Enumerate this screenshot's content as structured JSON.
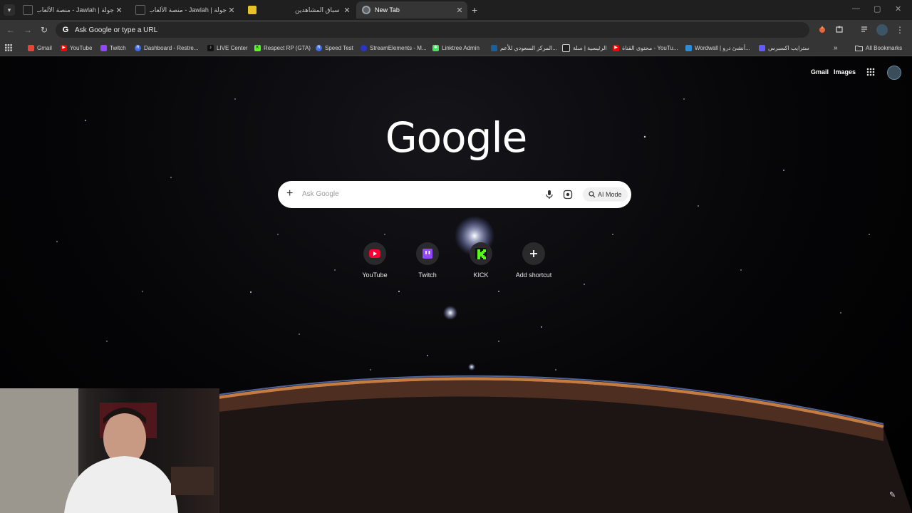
{
  "tabs": [
    {
      "title": "جولة | Jawlah - منصة الألعاب الت..."
    },
    {
      "title": "جولة | Jawlah - منصة الألعاب الت..."
    },
    {
      "title": ""
    },
    {
      "title": "سباق المشاهدين"
    },
    {
      "title": "New Tab",
      "active": true
    }
  ],
  "omnibox": {
    "placeholder": "Ask Google or type a URL"
  },
  "bookmarks": [
    {
      "label": "Gmail",
      "icon": "gmail-icon",
      "color": "#ea4335"
    },
    {
      "label": "YouTube",
      "icon": "youtube-icon",
      "color": "#ff0000"
    },
    {
      "label": "Twitch",
      "icon": "twitch-icon",
      "color": "#9146ff"
    },
    {
      "label": "Dashboard - Restre...",
      "icon": "restream-icon",
      "color": "#3d6cf2"
    },
    {
      "label": "LIVE Center",
      "icon": "tiktok-icon",
      "color": "#111111"
    },
    {
      "label": "Respect RP (GTA)",
      "icon": "kick-icon",
      "color": "#53fc18"
    },
    {
      "label": "Speed Test",
      "icon": "speedtest-icon",
      "color": "#3d6cf2"
    },
    {
      "label": "StreamElements - M...",
      "icon": "streamelements-icon",
      "color": "#2a34c9"
    },
    {
      "label": "Linktree Admin",
      "icon": "linktree-icon",
      "color": "#43e660"
    },
    {
      "label": "المركز السعودي للأعم...",
      "icon": "center-icon",
      "color": "#1b5e9c"
    },
    {
      "label": "الرئيسية | سلة",
      "icon": "salla-icon",
      "color": "#1f1f1f"
    },
    {
      "label": "محتوى القناة - YouTu...",
      "icon": "youtube-icon",
      "color": "#ff0000"
    },
    {
      "label": "Wordwall | أنشئ درو...",
      "icon": "wordwall-icon",
      "color": "#2e8bd6"
    },
    {
      "label": "سترايب اكسبرس",
      "icon": "stripe-icon",
      "color": "#635bff"
    }
  ],
  "all_bookmarks": "All Bookmarks",
  "header": {
    "gmail": "Gmail",
    "images": "Images"
  },
  "logo": "Google",
  "search": {
    "placeholder": "Ask Google",
    "ai_mode": "AI Mode"
  },
  "shortcuts": [
    {
      "label": "YouTube",
      "icon": "youtube-icon",
      "color": "#ff0033"
    },
    {
      "label": "Twitch",
      "icon": "twitch-icon",
      "color": "#9146ff"
    },
    {
      "label": "KICK",
      "icon": "kick-icon",
      "color": "#53fc18"
    },
    {
      "label": "Add shortcut",
      "icon": "plus-icon",
      "color": "#ffffff"
    }
  ]
}
